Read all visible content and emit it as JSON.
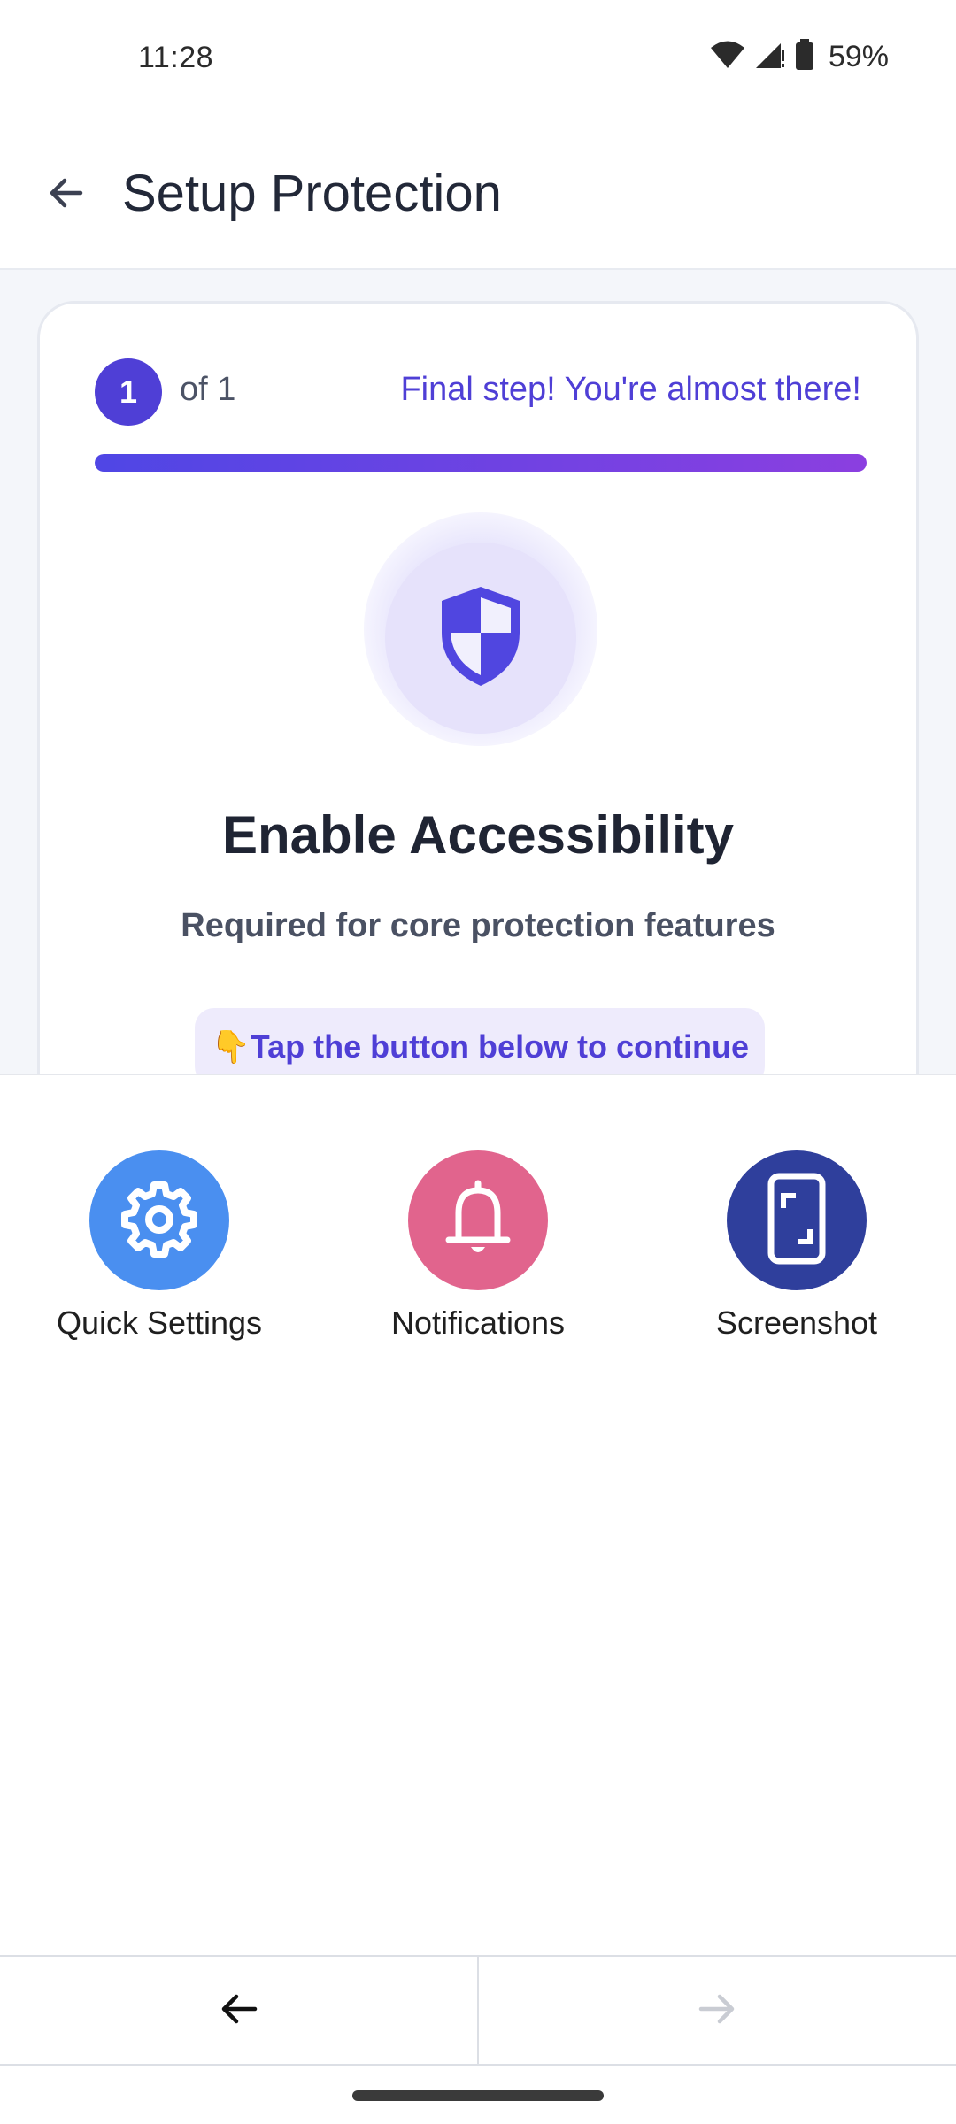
{
  "status_bar": {
    "time": "11:28",
    "battery": "59%",
    "icons": [
      "wifi-icon",
      "cellular-signal-icon",
      "battery-icon"
    ]
  },
  "app_bar": {
    "title": "Setup Protection",
    "back_icon": "arrow-left-icon"
  },
  "card": {
    "step_number": "1",
    "step_total": "of 1",
    "step_note": "Final step! You're almost there!",
    "progress": 1.0,
    "icon": "shield-icon",
    "title": "Enable Accessibility",
    "subtitle": "Required for core protection features",
    "hint": "👇Tap the button below to continue"
  },
  "sheet": {
    "actions": [
      {
        "label": "Quick Settings",
        "icon": "gear-icon",
        "color": "#4a8ff0"
      },
      {
        "label": "Notifications",
        "icon": "bell-icon",
        "color": "#e1648d"
      },
      {
        "label": "Screenshot",
        "icon": "screenshot-icon",
        "color": "#2f3f9c"
      }
    ]
  },
  "bottom_nav": {
    "back_icon": "arrow-left-icon",
    "forward_icon": "arrow-right-icon"
  },
  "colors": {
    "accent": "#4f3fd6",
    "progress_gradient_end": "#8b3fe0"
  }
}
